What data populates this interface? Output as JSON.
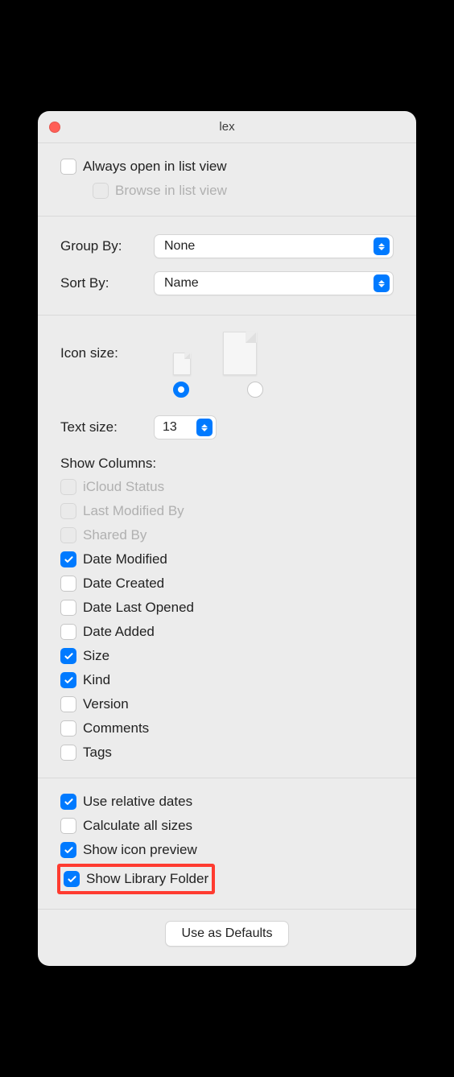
{
  "window": {
    "title": "lex"
  },
  "top_section": {
    "always_open_label": "Always open in list view",
    "always_open_checked": false,
    "browse_label": "Browse in list view",
    "browse_checked": false,
    "browse_enabled": false
  },
  "group_sort": {
    "group_by_label": "Group By:",
    "group_by_value": "None",
    "sort_by_label": "Sort By:",
    "sort_by_value": "Name"
  },
  "sizing": {
    "icon_size_label": "Icon size:",
    "icon_size_selected": "small",
    "text_size_label": "Text size:",
    "text_size_value": "13"
  },
  "columns": {
    "heading": "Show Columns:",
    "items": [
      {
        "label": "iCloud Status",
        "checked": false,
        "enabled": false
      },
      {
        "label": "Last Modified By",
        "checked": false,
        "enabled": false
      },
      {
        "label": "Shared By",
        "checked": false,
        "enabled": false
      },
      {
        "label": "Date Modified",
        "checked": true,
        "enabled": true
      },
      {
        "label": "Date Created",
        "checked": false,
        "enabled": true
      },
      {
        "label": "Date Last Opened",
        "checked": false,
        "enabled": true
      },
      {
        "label": "Date Added",
        "checked": false,
        "enabled": true
      },
      {
        "label": "Size",
        "checked": true,
        "enabled": true
      },
      {
        "label": "Kind",
        "checked": true,
        "enabled": true
      },
      {
        "label": "Version",
        "checked": false,
        "enabled": true
      },
      {
        "label": "Comments",
        "checked": false,
        "enabled": true
      },
      {
        "label": "Tags",
        "checked": false,
        "enabled": true
      }
    ]
  },
  "options": {
    "relative_dates": {
      "label": "Use relative dates",
      "checked": true
    },
    "calc_sizes": {
      "label": "Calculate all sizes",
      "checked": false
    },
    "icon_preview": {
      "label": "Show icon preview",
      "checked": true
    },
    "library_folder": {
      "label": "Show Library Folder",
      "checked": true,
      "highlighted": true
    }
  },
  "footer": {
    "defaults_label": "Use as Defaults"
  }
}
